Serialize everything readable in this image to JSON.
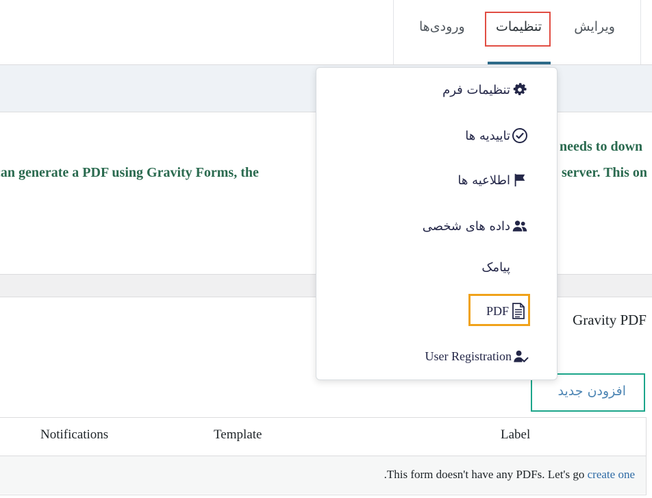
{
  "tabs": {
    "edit": "ویرایش",
    "settings": "تنظیمات",
    "entries": "ورودی‌ها"
  },
  "notice": {
    "line1": "needs to down",
    "line2": "can generate a PDF using Gravity Forms, the",
    "line2_right": "server. This on"
  },
  "section": {
    "title": "Gravity PDF"
  },
  "add_new_label": "افزودن جدید",
  "table": {
    "headers": [
      "Notifications",
      "Template",
      "Label"
    ],
    "empty_prefix": ".This form doesn't have any PDFs. Let's go ",
    "empty_link": "create one"
  },
  "menu": {
    "items": [
      {
        "label": "تنظیمات فرم",
        "icon": "gear-icon"
      },
      {
        "label": "تاییدیه ها",
        "icon": "check-circle-icon"
      },
      {
        "label": "اطلاعیه ها",
        "icon": "flag-icon"
      },
      {
        "label": "داده های شخصی",
        "icon": "users-icon"
      },
      {
        "label": "پیامک",
        "icon": ""
      },
      {
        "label": "PDF",
        "icon": "document-icon"
      },
      {
        "label": "User Registration",
        "icon": "user-check-icon"
      }
    ]
  },
  "colors": {
    "accent": "#2e6b8a",
    "highlight_red": "#e14d43",
    "highlight_orange": "#f0a21a",
    "highlight_green": "#1ba58a",
    "notice_text": "#2a6a4f",
    "link": "#2e6ba5"
  }
}
